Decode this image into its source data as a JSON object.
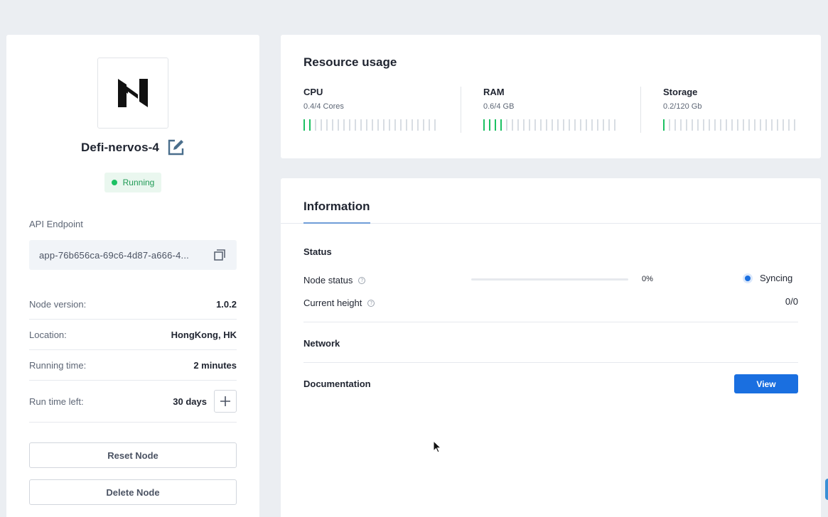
{
  "node": {
    "name": "Defi-nervos-4",
    "status": "Running",
    "api_label": "API Endpoint",
    "api_value": "app-76b656ca-69c6-4d87-a666-4...",
    "details": [
      {
        "label": "Node version:",
        "value": "1.0.2"
      },
      {
        "label": "Location:",
        "value": "HongKong, HK"
      },
      {
        "label": "Running time:",
        "value": "2 minutes"
      },
      {
        "label": "Run time left:",
        "value": "30 days"
      }
    ],
    "buttons": {
      "reset": "Reset Node",
      "delete": "Delete Node"
    }
  },
  "resources": {
    "title": "Resource usage",
    "items": [
      {
        "name": "CPU",
        "usage": "0.4/4 Cores",
        "fraction": 0.1
      },
      {
        "name": "RAM",
        "usage": "0.6/4 GB",
        "fraction": 0.15
      },
      {
        "name": "Storage",
        "usage": "0.2/120 Gb",
        "fraction": 0.0017
      }
    ]
  },
  "information": {
    "tab": "Information",
    "status_heading": "Status",
    "node_status_label": "Node status",
    "progress_percent": 0,
    "progress_text": "0%",
    "sync_text": "Syncing",
    "current_height_label": "Current height",
    "current_height_value": "0/0",
    "network_heading": "Network",
    "documentation_heading": "Documentation",
    "view_label": "View"
  },
  "colors": {
    "accent": "#1a6fe0",
    "success": "#1cc163",
    "background": "#ebeef2"
  }
}
